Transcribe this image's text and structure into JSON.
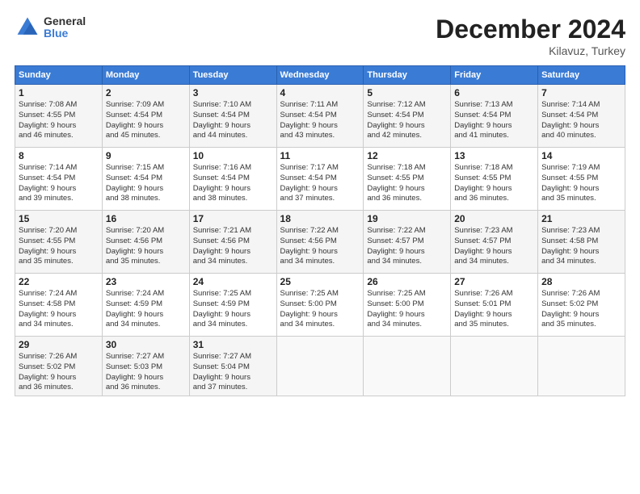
{
  "header": {
    "logo_general": "General",
    "logo_blue": "Blue",
    "month_title": "December 2024",
    "location": "Kilavuz, Turkey"
  },
  "days_of_week": [
    "Sunday",
    "Monday",
    "Tuesday",
    "Wednesday",
    "Thursday",
    "Friday",
    "Saturday"
  ],
  "weeks": [
    [
      {
        "day": 1,
        "sunrise": "7:08 AM",
        "sunset": "4:55 PM",
        "daylight": "9 hours and 46 minutes."
      },
      {
        "day": 2,
        "sunrise": "7:09 AM",
        "sunset": "4:54 PM",
        "daylight": "9 hours and 45 minutes."
      },
      {
        "day": 3,
        "sunrise": "7:10 AM",
        "sunset": "4:54 PM",
        "daylight": "9 hours and 44 minutes."
      },
      {
        "day": 4,
        "sunrise": "7:11 AM",
        "sunset": "4:54 PM",
        "daylight": "9 hours and 43 minutes."
      },
      {
        "day": 5,
        "sunrise": "7:12 AM",
        "sunset": "4:54 PM",
        "daylight": "9 hours and 42 minutes."
      },
      {
        "day": 6,
        "sunrise": "7:13 AM",
        "sunset": "4:54 PM",
        "daylight": "9 hours and 41 minutes."
      },
      {
        "day": 7,
        "sunrise": "7:14 AM",
        "sunset": "4:54 PM",
        "daylight": "9 hours and 40 minutes."
      }
    ],
    [
      {
        "day": 8,
        "sunrise": "7:14 AM",
        "sunset": "4:54 PM",
        "daylight": "9 hours and 39 minutes."
      },
      {
        "day": 9,
        "sunrise": "7:15 AM",
        "sunset": "4:54 PM",
        "daylight": "9 hours and 38 minutes."
      },
      {
        "day": 10,
        "sunrise": "7:16 AM",
        "sunset": "4:54 PM",
        "daylight": "9 hours and 38 minutes."
      },
      {
        "day": 11,
        "sunrise": "7:17 AM",
        "sunset": "4:54 PM",
        "daylight": "9 hours and 37 minutes."
      },
      {
        "day": 12,
        "sunrise": "7:18 AM",
        "sunset": "4:55 PM",
        "daylight": "9 hours and 36 minutes."
      },
      {
        "day": 13,
        "sunrise": "7:18 AM",
        "sunset": "4:55 PM",
        "daylight": "9 hours and 36 minutes."
      },
      {
        "day": 14,
        "sunrise": "7:19 AM",
        "sunset": "4:55 PM",
        "daylight": "9 hours and 35 minutes."
      }
    ],
    [
      {
        "day": 15,
        "sunrise": "7:20 AM",
        "sunset": "4:55 PM",
        "daylight": "9 hours and 35 minutes."
      },
      {
        "day": 16,
        "sunrise": "7:20 AM",
        "sunset": "4:56 PM",
        "daylight": "9 hours and 35 minutes."
      },
      {
        "day": 17,
        "sunrise": "7:21 AM",
        "sunset": "4:56 PM",
        "daylight": "9 hours and 34 minutes."
      },
      {
        "day": 18,
        "sunrise": "7:22 AM",
        "sunset": "4:56 PM",
        "daylight": "9 hours and 34 minutes."
      },
      {
        "day": 19,
        "sunrise": "7:22 AM",
        "sunset": "4:57 PM",
        "daylight": "9 hours and 34 minutes."
      },
      {
        "day": 20,
        "sunrise": "7:23 AM",
        "sunset": "4:57 PM",
        "daylight": "9 hours and 34 minutes."
      },
      {
        "day": 21,
        "sunrise": "7:23 AM",
        "sunset": "4:58 PM",
        "daylight": "9 hours and 34 minutes."
      }
    ],
    [
      {
        "day": 22,
        "sunrise": "7:24 AM",
        "sunset": "4:58 PM",
        "daylight": "9 hours and 34 minutes."
      },
      {
        "day": 23,
        "sunrise": "7:24 AM",
        "sunset": "4:59 PM",
        "daylight": "9 hours and 34 minutes."
      },
      {
        "day": 24,
        "sunrise": "7:25 AM",
        "sunset": "4:59 PM",
        "daylight": "9 hours and 34 minutes."
      },
      {
        "day": 25,
        "sunrise": "7:25 AM",
        "sunset": "5:00 PM",
        "daylight": "9 hours and 34 minutes."
      },
      {
        "day": 26,
        "sunrise": "7:25 AM",
        "sunset": "5:00 PM",
        "daylight": "9 hours and 34 minutes."
      },
      {
        "day": 27,
        "sunrise": "7:26 AM",
        "sunset": "5:01 PM",
        "daylight": "9 hours and 35 minutes."
      },
      {
        "day": 28,
        "sunrise": "7:26 AM",
        "sunset": "5:02 PM",
        "daylight": "9 hours and 35 minutes."
      }
    ],
    [
      {
        "day": 29,
        "sunrise": "7:26 AM",
        "sunset": "5:02 PM",
        "daylight": "9 hours and 36 minutes."
      },
      {
        "day": 30,
        "sunrise": "7:27 AM",
        "sunset": "5:03 PM",
        "daylight": "9 hours and 36 minutes."
      },
      {
        "day": 31,
        "sunrise": "7:27 AM",
        "sunset": "5:04 PM",
        "daylight": "9 hours and 37 minutes."
      },
      null,
      null,
      null,
      null
    ]
  ],
  "labels": {
    "sunrise": "Sunrise:",
    "sunset": "Sunset:",
    "daylight": "Daylight:"
  }
}
